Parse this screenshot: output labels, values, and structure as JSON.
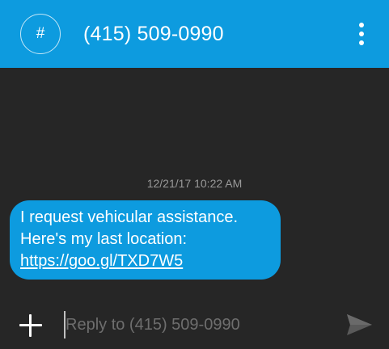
{
  "header": {
    "avatar_glyph": "#",
    "title": "(415) 509-0990",
    "accent_color": "#0d9bdf"
  },
  "conversation": {
    "timestamp": "12/21/17 10:22 AM",
    "message": {
      "line1": "I request vehicular assistance.",
      "line2": "Here's my last location:",
      "link": "https://goo.gl/TXD7W5"
    }
  },
  "composer": {
    "placeholder": "Reply to (415) 509-0990",
    "add_icon": "plus-icon",
    "send_icon": "send-icon"
  }
}
